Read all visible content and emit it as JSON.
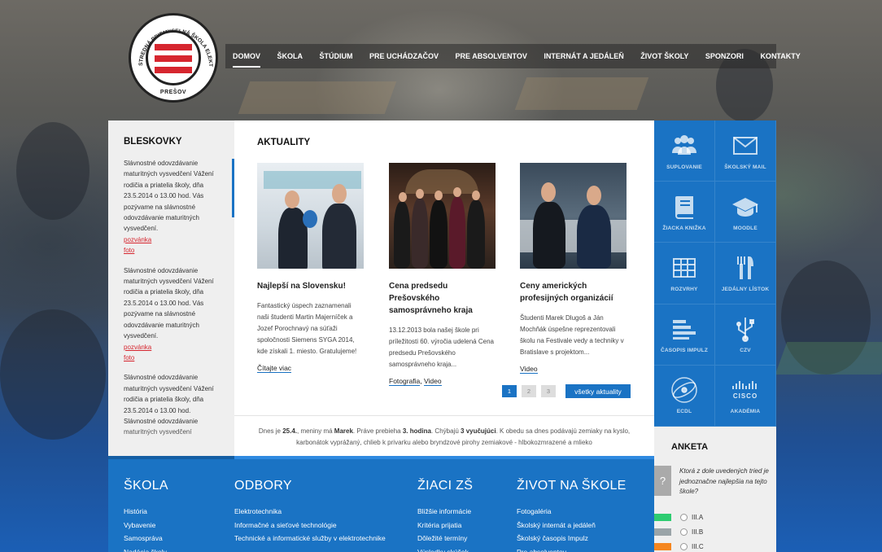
{
  "logo": {
    "arc_text": "STREDNÁ PRIEMYSELNÁ ŠKOLA ELEKTROTECHNICKÁ",
    "city": "PREŠOV"
  },
  "nav": {
    "items": [
      "DOMOV",
      "ŠKOLA",
      "ŠTÚDIUM",
      "PRE UCHÁDZAČOV",
      "PRE ABSOLVENTOV",
      "INTERNÁT A JEDÁLEŇ",
      "ŽIVOT ŠKOLY",
      "SPONZORI",
      "KONTAKTY"
    ],
    "active": "DOMOV"
  },
  "bleskovky": {
    "title": "BLESKOVKY",
    "entries": [
      {
        "text": "Slávnostné odovzdávanie maturitných vysvedčení Vážení rodičia a priatelia školy, dňa 23.5.2014 o 13.00 hod. Vás pozývame na slávnostné odovzdávanie maturitných vysvedčení.",
        "link1": "pozvánka",
        "link2": "foto"
      },
      {
        "text": "Slávnostné odovzdávanie maturitných vysvedčení Vážení rodičia a priatelia školy, dňa 23.5.2014 o 13.00 hod. Vás pozývame na slávnostné odovzdávanie maturitných vysvedčení.",
        "link1": "pozvánka",
        "link2": "foto"
      },
      {
        "text": "Slávnostné odovzdávanie maturitných vysvedčení Vážení rodičia a priatelia školy, dňa 23.5.2014 o 13.00 hod. Slávnostné odovzdávanie maturitných vysvedčení",
        "link1": "",
        "link2": ""
      }
    ]
  },
  "aktuality": {
    "title": "AKTUALITY",
    "cards": [
      {
        "title": "Najlepší na Slovensku!",
        "text": "Fantastický úspech zaznamenali naši študenti Martin Majerníček a Jozef Porochnavý na súťaži spoločnosti Siemens SYGA 2014, kde získali 1. miesto. Gratulujeme!",
        "links": [
          "Čítajte viac"
        ]
      },
      {
        "title": "Cena predsedu Prešovského samosprávneho kraja",
        "text": "13.12.2013 bola našej škole pri príležitosti 60. výročia udelená Cena predsedu Prešovského samosprávneho kraja...",
        "links": [
          "Fotografia",
          "Video"
        ]
      },
      {
        "title": "Ceny amerických profesijných organizácií",
        "text": "Študenti Marek Dlugoš a Ján Mochňák úspešne reprezentovali školu na Festivale vedy a techniky v Bratislave s projektom...",
        "links": [
          "Video"
        ]
      }
    ],
    "pages": [
      "1",
      "2",
      "3"
    ],
    "active_page": "1",
    "all_button": "všetky aktuality"
  },
  "info_bar": {
    "p1": "Dnes je ",
    "date": "25.4.",
    "p2": ", meniny má ",
    "name": "Marek",
    "p3": ". Práve prebieha ",
    "hour": "3. hodina",
    "p4": ". Chýbajú ",
    "missing": "3 vyučujúci",
    "p5": ". K obedu sa dnes podávajú zemiaky na kyslo, karbonátok vyprážaný, chlieb k privarku alebo bryndzové pirohy zemiakové - hlbokozmrazené a mlieko"
  },
  "tiles": [
    {
      "label": "SUPLOVANIE",
      "icon": "users-icon"
    },
    {
      "label": "ŠKOLSKÝ MAIL",
      "icon": "envelope-icon"
    },
    {
      "label": "ŽIACKA KNIŽKA",
      "icon": "book-icon"
    },
    {
      "label": "MOODLE",
      "icon": "graduation-cap-icon"
    },
    {
      "label": "ROZVRHY",
      "icon": "table-icon"
    },
    {
      "label": "JEDÁLNY LÍSTOK",
      "icon": "cutlery-icon"
    },
    {
      "label": "ČASOPIS IMPULZ",
      "icon": "bars-icon"
    },
    {
      "label": "CZV",
      "icon": "usb-icon"
    },
    {
      "label": "ECDL",
      "icon": "ecdl-icon"
    },
    {
      "label": "AKADÉMIA",
      "icon": "cisco-icon",
      "logo_text": "CISCO"
    }
  ],
  "anketa": {
    "title": "ANKETA",
    "question_mark": "?",
    "question": "Ktorá z dole uvedených tried je jednoznačne najlepšia na tejto škole?",
    "options": [
      {
        "label": "III.A",
        "color": "#2ecc71"
      },
      {
        "label": "III.B",
        "color": "#9aa4a8"
      },
      {
        "label": "III.C",
        "color": "#f5861f"
      }
    ]
  },
  "footer": {
    "columns": [
      {
        "title": "ŠKOLA",
        "links": [
          "História",
          "Vybavenie",
          "Samospráva",
          "Nadácia školy"
        ]
      },
      {
        "title": "ODBORY",
        "links": [
          "Elektrotechnika",
          "Informačné a sieťové technológie",
          "Technické a informatické služby v elektrotechnike"
        ]
      },
      {
        "title": "ŽIACI ZŠ",
        "links": [
          "Bližšie informácie",
          "Kritéria prijatia",
          "Dôležité termíny",
          "Výsledky skúšok"
        ]
      },
      {
        "title": "ŽIVOT NA ŠKOLE",
        "links": [
          "Fotogaléria",
          "Školský internát a jedáleň",
          "Školský časopis Impulz",
          "Pre absolventov"
        ]
      }
    ]
  },
  "colors": {
    "accent_blue": "#1a73c4",
    "accent_red": "#d6262f"
  }
}
